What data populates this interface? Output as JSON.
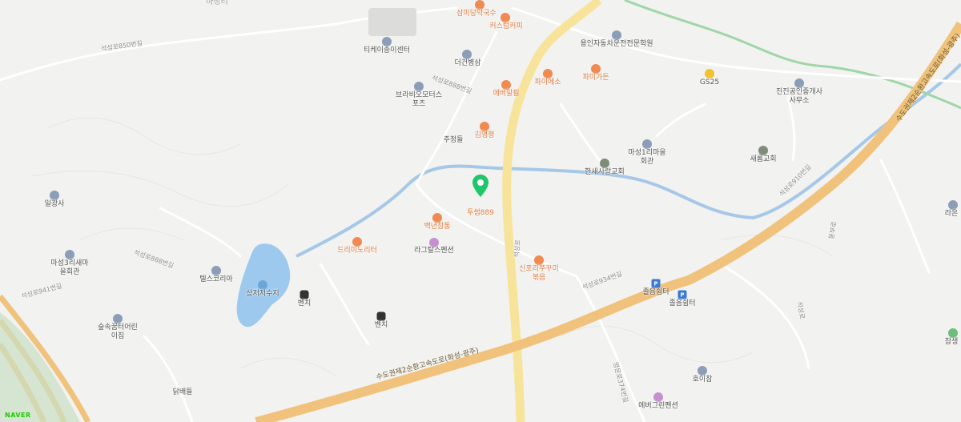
{
  "map": {
    "selected_marker_label": "투썸889",
    "logo": "NAVER",
    "colors": {
      "background": "#f2f2f0",
      "highway": "#f0c27b",
      "expressway": "#f7e49a",
      "river": "#a5c8e8",
      "water": "#9ec9ef",
      "marker": "#1ec76b"
    },
    "top_label": "마정리",
    "pois": [
      {
        "name": "삼미당막국수",
        "type": "food"
      },
      {
        "name": "커스텀커피",
        "type": "food"
      },
      {
        "name": "티케이송이센터",
        "type": "poi"
      },
      {
        "name": "더건병삼",
        "type": "poi"
      },
      {
        "name": "용인자동차운전전문학원",
        "type": "poi"
      },
      {
        "name": "브라비오모터스포츠",
        "type": "poi"
      },
      {
        "name": "에버랄필",
        "type": "food"
      },
      {
        "name": "파이에소",
        "type": "food"
      },
      {
        "name": "파미가든",
        "type": "food"
      },
      {
        "name": "GS25",
        "type": "gs"
      },
      {
        "name": "진진공인중개사사무소",
        "type": "poi"
      },
      {
        "name": "주정들",
        "type": "place"
      },
      {
        "name": "김명평",
        "type": "food"
      },
      {
        "name": "마성1리마을회관",
        "type": "poi"
      },
      {
        "name": "새롬교회",
        "type": "church"
      },
      {
        "name": "한새사랑교회",
        "type": "church"
      },
      {
        "name": "일광사",
        "type": "poi"
      },
      {
        "name": "백년참통",
        "type": "food"
      },
      {
        "name": "라그탈스펜션",
        "type": "pension"
      },
      {
        "name": "드리미노리터",
        "type": "food"
      },
      {
        "name": "마성3리새마을회관",
        "type": "poi"
      },
      {
        "name": "텔스코리아",
        "type": "poi"
      },
      {
        "name": "신포리쭈꾸미볶음",
        "type": "food"
      },
      {
        "name": "졸음쉼터",
        "type": "rest"
      },
      {
        "name": "졸음쉼터",
        "type": "rest"
      },
      {
        "name": "상저저수지",
        "type": "park"
      },
      {
        "name": "벤치",
        "type": "bus"
      },
      {
        "name": "벤치",
        "type": "bus"
      },
      {
        "name": "숲속꿈터어린이집",
        "type": "poi"
      },
      {
        "name": "호이참",
        "type": "poi"
      },
      {
        "name": "에버그린펜션",
        "type": "pension"
      },
      {
        "name": "닭배들",
        "type": "place"
      },
      {
        "name": "라온",
        "type": "poi"
      },
      {
        "name": "참생",
        "type": "park"
      }
    ],
    "roads": [
      "석성로850번길",
      "석성로888번길",
      "석성로888번길",
      "석성로941번길",
      "석성로934번길",
      "석성로910번길",
      "석성로",
      "동부로",
      "석성로",
      "영문로374번길"
    ],
    "highway_label": "수도권제2순환고속도로(화성-광주)",
    "highway_label_2": "수도권제2순환고속도로(화성-광주)"
  }
}
